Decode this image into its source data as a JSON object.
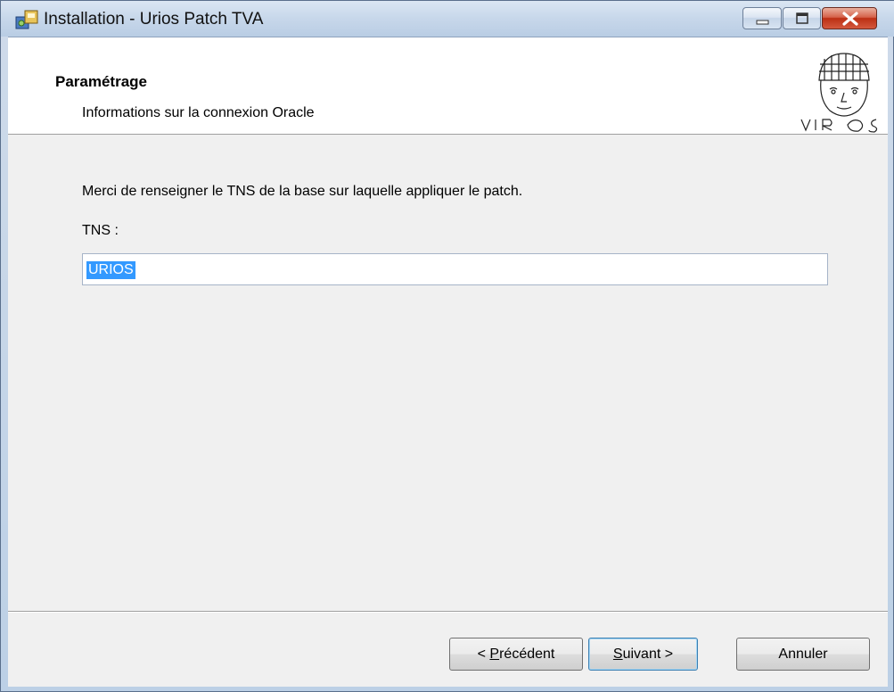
{
  "window": {
    "title": "Installation - Urios Patch TVA",
    "controls": {
      "minimize": "minimize-icon",
      "maximize": "maximize-icon",
      "close": "close-icon"
    }
  },
  "header": {
    "title": "Paramétrage",
    "subtitle": "Informations sur la connexion Oracle",
    "logo_icon": "urios-logo-icon"
  },
  "main": {
    "instruction": "Merci de renseigner le TNS de la base sur laquelle appliquer le patch.",
    "tns_label": "TNS :",
    "tns_value": "URIOS"
  },
  "buttons": {
    "prev_prefix": "< ",
    "prev_accel": "P",
    "prev_rest": "récédent",
    "next_accel": "S",
    "next_rest": "uivant >",
    "cancel": "Annuler"
  },
  "colors": {
    "selection": "#3399ff",
    "close_button": "#c8452a"
  }
}
